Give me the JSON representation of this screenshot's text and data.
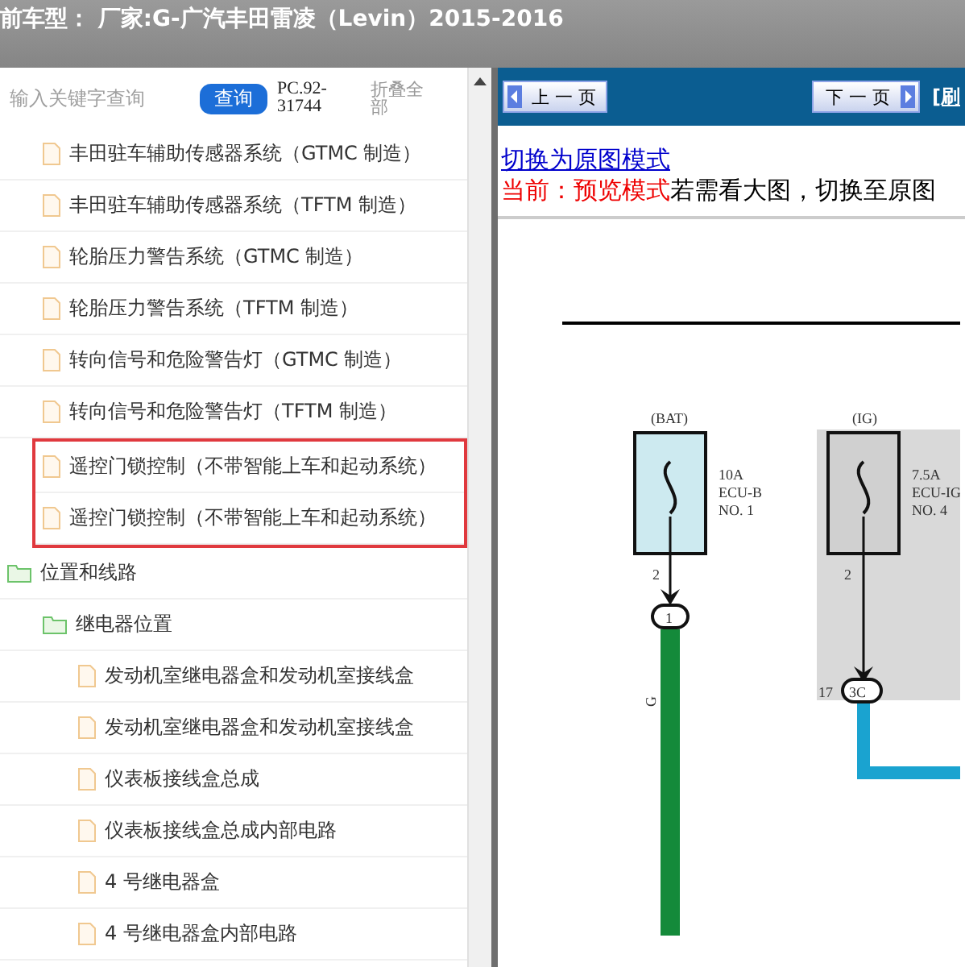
{
  "title_bar": {
    "title": "前车型： 厂家:G-广汽丰田雷凌（Levin）2015-2016"
  },
  "sidebar": {
    "search": {
      "placeholder": "输入关键字查询"
    },
    "search_button": "查询",
    "code": "PC.92-31744",
    "collapse_all": "折叠全部",
    "tree": [
      {
        "children": [
          {
            "kind": "doc",
            "label": "丰田驻车辅助传感器系统（GTMC 制造）",
            "highlighted": false
          },
          {
            "kind": "doc",
            "label": "丰田驻车辅助传感器系统（TFTM 制造）",
            "highlighted": false
          },
          {
            "kind": "doc",
            "label": "轮胎压力警告系统（GTMC 制造）",
            "highlighted": false
          },
          {
            "kind": "doc",
            "label": "轮胎压力警告系统（TFTM 制造）",
            "highlighted": false
          },
          {
            "kind": "doc",
            "label": "转向信号和危险警告灯（GTMC 制造）",
            "highlighted": false
          },
          {
            "kind": "doc",
            "label": "转向信号和危险警告灯（TFTM 制造）",
            "highlighted": false
          },
          {
            "kind": "doc",
            "label": "遥控门锁控制（不带智能上车和起动系统）",
            "highlighted": true
          },
          {
            "kind": "doc",
            "label": "遥控门锁控制（不带智能上车和起动系统）",
            "highlighted": true
          }
        ]
      },
      {
        "kind": "folder",
        "label": "位置和线路",
        "highlighted": false,
        "children": [
          {
            "kind": "folder",
            "label": "继电器位置",
            "highlighted": false,
            "children": [
              {
                "kind": "doc",
                "label": "发动机室继电器盒和发动机室接线盒",
                "highlighted": false
              },
              {
                "kind": "doc",
                "label": "发动机室继电器盒和发动机室接线盒",
                "highlighted": false
              },
              {
                "kind": "doc",
                "label": "仪表板接线盒总成",
                "highlighted": false
              },
              {
                "kind": "doc",
                "label": "仪表板接线盒总成内部电路",
                "highlighted": false
              },
              {
                "kind": "doc",
                "label": "4 号继电器盒",
                "highlighted": false
              },
              {
                "kind": "doc",
                "label": "4 号继电器盒内部电路",
                "highlighted": false
              }
            ]
          }
        ]
      }
    ]
  },
  "viewer": {
    "prev_button": "上 一 页",
    "next_button": "下 一 页",
    "refresh_link": "[刷",
    "mode_link": "切换为原图模式",
    "mode_status": "当前：预览模式",
    "mode_hint": "若需看大图，切换至原图",
    "diagram": {
      "bat": {
        "source": "(BAT)",
        "rating": "10A",
        "fuse": "ECU-B",
        "number": "NO. 1",
        "pin": "2",
        "connector": "1",
        "wire": "G"
      },
      "ig": {
        "source": "(IG)",
        "rating": "7.5A",
        "fuse": "ECU-IG",
        "number": "NO. 4",
        "pin": "2",
        "connector_pin": "17",
        "connector": "3C"
      }
    }
  }
}
